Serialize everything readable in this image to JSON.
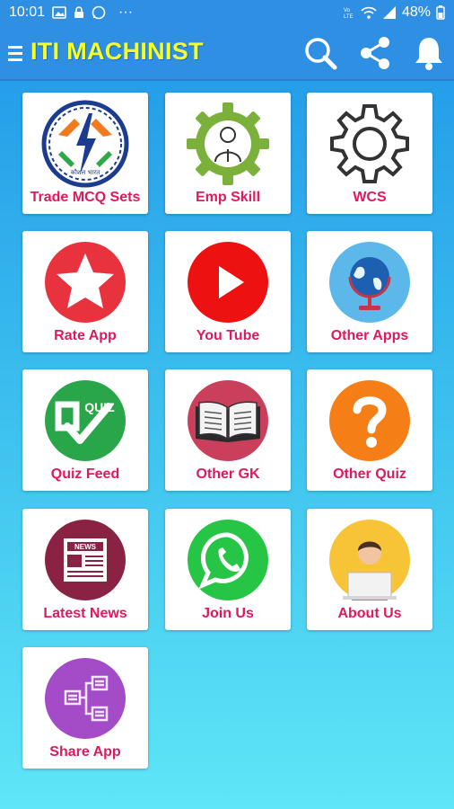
{
  "status_bar": {
    "time": "10:01",
    "more": "···",
    "battery": "48%"
  },
  "app_bar": {
    "title": "ITI MACHINIST"
  },
  "tiles": [
    {
      "label": "Trade MCQ Sets",
      "icon": "skill-india-logo-icon"
    },
    {
      "label": "Emp Skill",
      "icon": "gear-person-icon"
    },
    {
      "label": "WCS",
      "icon": "gear-icon"
    },
    {
      "label": "Rate App",
      "icon": "star-icon"
    },
    {
      "label": "You Tube",
      "icon": "youtube-icon"
    },
    {
      "label": "Other Apps",
      "icon": "globe-icon"
    },
    {
      "label": "Quiz Feed",
      "icon": "quiz-icon"
    },
    {
      "label": "Other GK",
      "icon": "book-icon"
    },
    {
      "label": "Other Quiz",
      "icon": "question-icon"
    },
    {
      "label": "Latest News",
      "icon": "news-icon"
    },
    {
      "label": "Join Us",
      "icon": "whatsapp-icon"
    },
    {
      "label": "About Us",
      "icon": "person-laptop-icon"
    },
    {
      "label": "Share App",
      "icon": "share-nodes-icon"
    }
  ],
  "logo_text": {
    "quiz": "QUIZ",
    "news": "NEWS",
    "skill": "कौशल भारत"
  },
  "colors": {
    "accent": "#e0195e",
    "appbar": "#2f8fe2",
    "title": "#f4ff2a"
  }
}
